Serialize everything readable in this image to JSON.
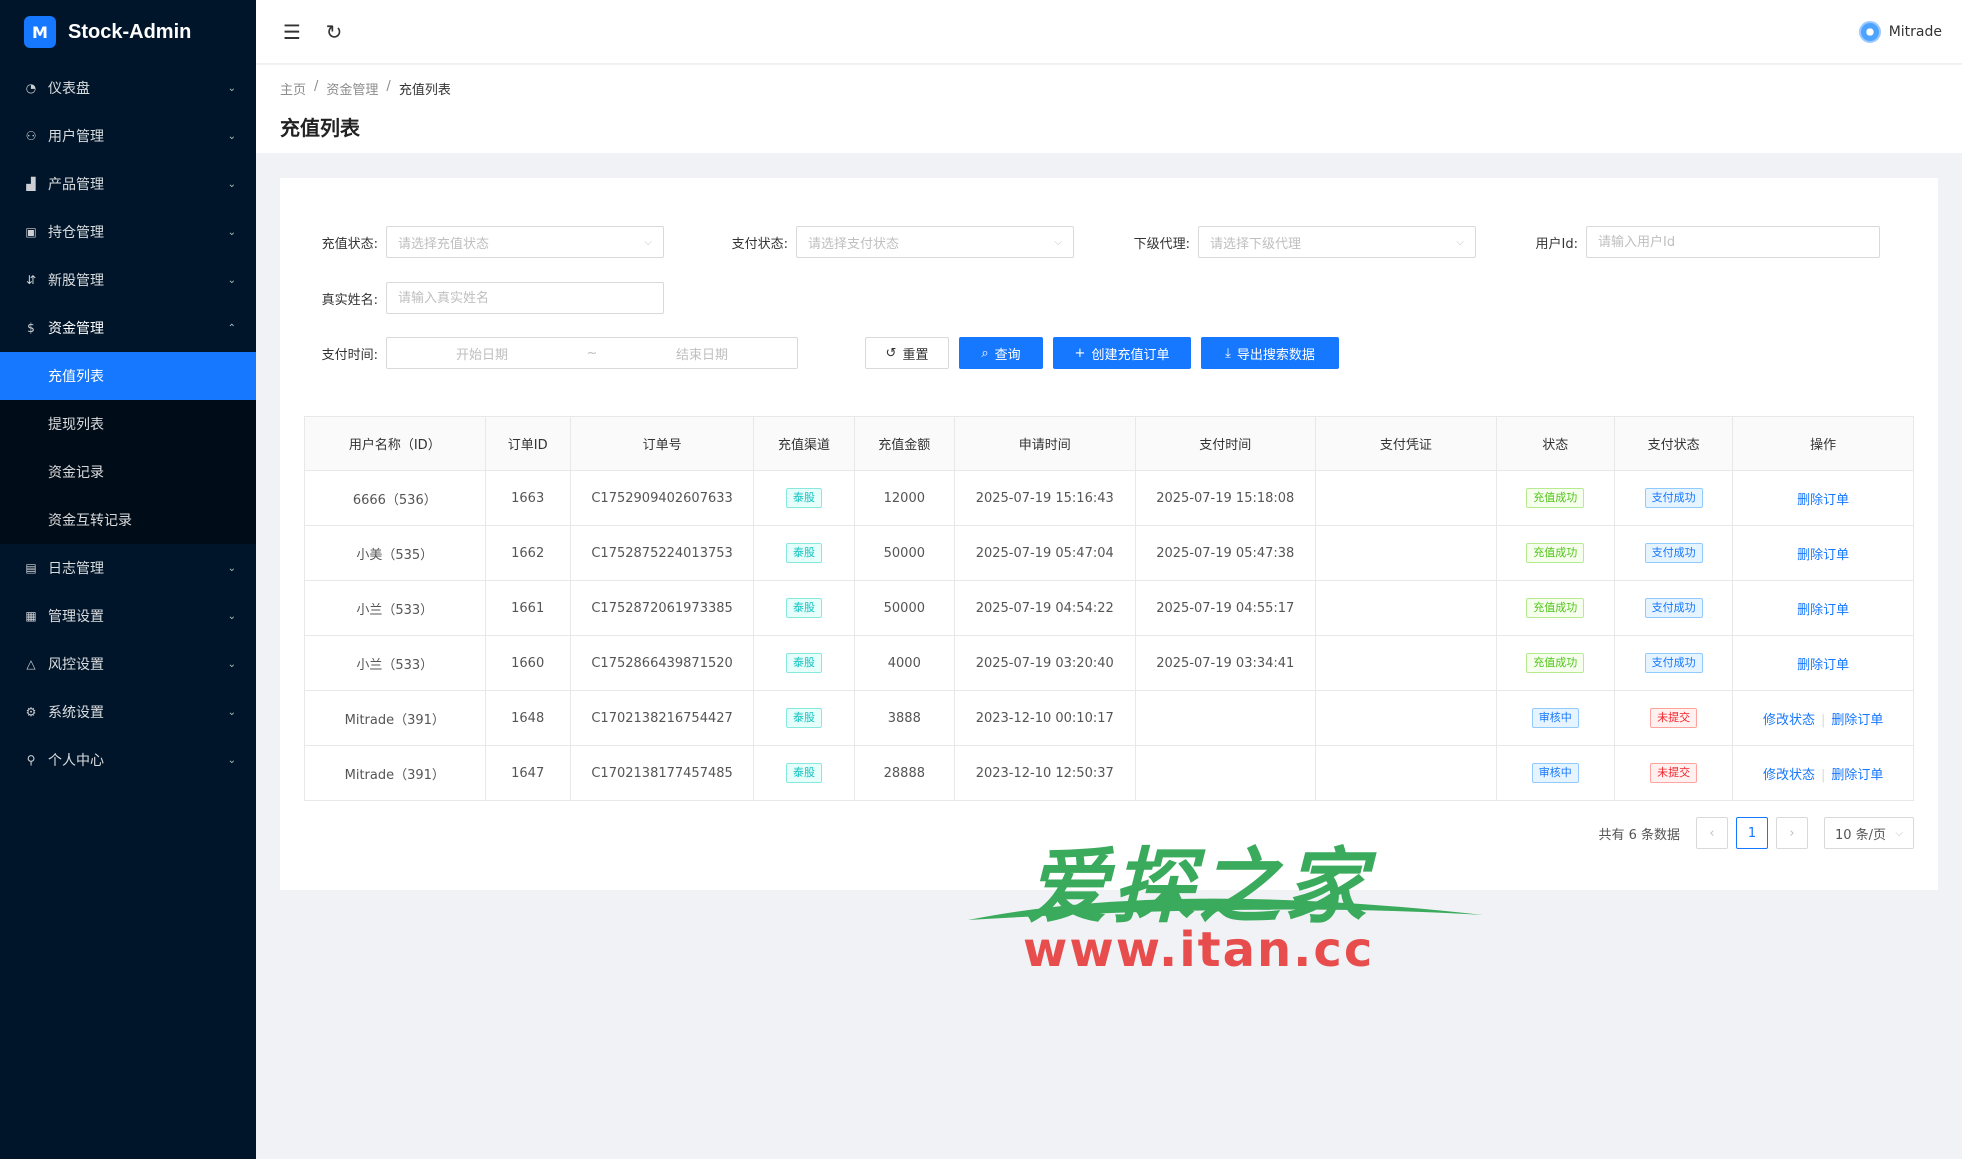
{
  "app": {
    "title": "Stock-Admin",
    "logo_text": "M"
  },
  "sidebar": {
    "items": [
      {
        "label": "仪表盘",
        "icon": "dashboard-icon"
      },
      {
        "label": "用户管理",
        "icon": "users-icon"
      },
      {
        "label": "产品管理",
        "icon": "chart-icon"
      },
      {
        "label": "持仓管理",
        "icon": "position-icon"
      },
      {
        "label": "新股管理",
        "icon": "new-stock-icon"
      },
      {
        "label": "资金管理",
        "icon": "dollar-icon"
      },
      {
        "label": "日志管理",
        "icon": "log-icon"
      },
      {
        "label": "管理设置",
        "icon": "admin-settings-icon"
      },
      {
        "label": "风控设置",
        "icon": "warning-icon"
      },
      {
        "label": "系统设置",
        "icon": "gear-icon"
      },
      {
        "label": "个人中心",
        "icon": "user-icon"
      }
    ],
    "fund_sub": [
      "充值列表",
      "提现列表",
      "资金记录",
      "资金互转记录"
    ]
  },
  "header": {
    "username": "Mitrade"
  },
  "breadcrumb": [
    "主页",
    "资金管理",
    "充值列表"
  ],
  "page_title": "充值列表",
  "filters": {
    "recharge_status_label": "充值状态:",
    "recharge_status_placeholder": "请选择充值状态",
    "pay_status_label": "支付状态:",
    "pay_status_placeholder": "请选择支付状态",
    "agent_label": "下级代理:",
    "agent_placeholder": "请选择下级代理",
    "user_id_label": "用户Id:",
    "user_id_placeholder": "请输入用户Id",
    "real_name_label": "真实姓名:",
    "real_name_placeholder": "请输入真实姓名",
    "pay_time_label": "支付时间:",
    "start_date": "开始日期",
    "range_sep": "~",
    "end_date": "结束日期"
  },
  "buttons": {
    "reset": "重置",
    "search": "查询",
    "create": "创建充值订单",
    "export": "导出搜索数据"
  },
  "table": {
    "columns": [
      "用户名称（ID）",
      "订单ID",
      "订单号",
      "充值渠道",
      "充值金额",
      "申请时间",
      "支付时间",
      "支付凭证",
      "状态",
      "支付状态",
      "操作"
    ],
    "rows": [
      {
        "user": "6666（536）",
        "id": "1663",
        "order_no": "C1752909402607633",
        "channel": "泰股",
        "amount": "12000",
        "apply_time": "2025-07-19 15:16:43",
        "pay_time": "2025-07-19 15:18:08",
        "voucher": "",
        "status": "充值成功",
        "pay_status": "支付成功",
        "actions": [
          "删除订单"
        ]
      },
      {
        "user": "小美（535）",
        "id": "1662",
        "order_no": "C1752875224013753",
        "channel": "泰股",
        "amount": "50000",
        "apply_time": "2025-07-19 05:47:04",
        "pay_time": "2025-07-19 05:47:38",
        "voucher": "",
        "status": "充值成功",
        "pay_status": "支付成功",
        "actions": [
          "删除订单"
        ]
      },
      {
        "user": "小兰（533）",
        "id": "1661",
        "order_no": "C1752872061973385",
        "channel": "泰股",
        "amount": "50000",
        "apply_time": "2025-07-19 04:54:22",
        "pay_time": "2025-07-19 04:55:17",
        "voucher": "",
        "status": "充值成功",
        "pay_status": "支付成功",
        "actions": [
          "删除订单"
        ]
      },
      {
        "user": "小兰（533）",
        "id": "1660",
        "order_no": "C1752866439871520",
        "channel": "泰股",
        "amount": "4000",
        "apply_time": "2025-07-19 03:20:40",
        "pay_time": "2025-07-19 03:34:41",
        "voucher": "",
        "status": "充值成功",
        "pay_status": "支付成功",
        "actions": [
          "删除订单"
        ]
      },
      {
        "user": "Mitrade（391）",
        "id": "1648",
        "order_no": "C1702138216754427",
        "channel": "泰股",
        "amount": "3888",
        "apply_time": "2023-12-10 00:10:17",
        "pay_time": "",
        "voucher": "",
        "status": "审核中",
        "pay_status": "未提交",
        "actions": [
          "修改状态",
          "删除订单"
        ]
      },
      {
        "user": "Mitrade（391）",
        "id": "1647",
        "order_no": "C1702138177457485",
        "channel": "泰股",
        "amount": "28888",
        "apply_time": "2023-12-10 12:50:37",
        "pay_time": "",
        "voucher": "",
        "status": "审核中",
        "pay_status": "未提交",
        "actions": [
          "修改状态",
          "删除订单"
        ]
      }
    ]
  },
  "pagination": {
    "total": "共有 6 条数据",
    "current": "1",
    "page_size": "10 条/页"
  },
  "watermark": {
    "cn": "爱探之家",
    "url": "www.itan.cc"
  },
  "colors": {
    "sidebar_bg": "#001529",
    "primary": "#1677ff",
    "success": "#52c41a",
    "danger": "#f5222d",
    "cyan": "#13c2c2"
  }
}
